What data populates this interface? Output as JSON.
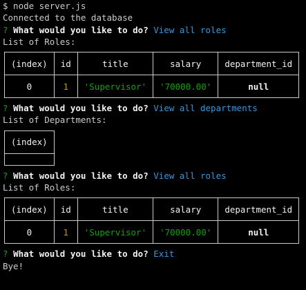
{
  "session": {
    "command": "$ node server.js",
    "connected": "Connected to the database",
    "prompt_marker": "?",
    "prompt_text": "What would you like to do?",
    "answers": [
      "View all roles",
      "View all departments",
      "View all roles",
      "Exit"
    ],
    "list_roles_label": "List of Roles:",
    "list_departments_label": "List of Departments:",
    "bye": "Bye!"
  },
  "roles_table": {
    "headers": [
      "(index)",
      "id",
      "title",
      "salary",
      "department_id"
    ],
    "rows": [
      [
        "0",
        "1",
        "'Supervisor'",
        "'70000.00'",
        "null"
      ]
    ]
  },
  "departments_table": {
    "headers": [
      "(index)"
    ]
  },
  "colors": {
    "background": "#000000",
    "text": "#cccccc",
    "question_mark": "#13a10e",
    "answer": "#3a96dd",
    "number": "#c19c00",
    "string": "#13a10e"
  }
}
